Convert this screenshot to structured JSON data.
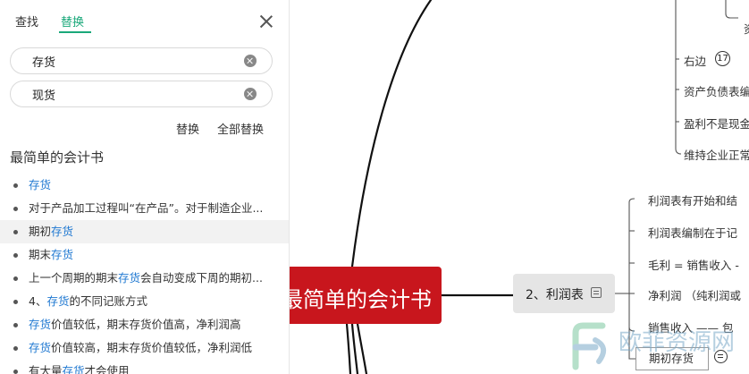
{
  "panel": {
    "tabs": [
      {
        "label": "查找",
        "active": false
      },
      {
        "label": "替换",
        "active": true
      }
    ],
    "find_value": "存货",
    "replace_value": "现货",
    "replace_label": "替换",
    "replace_all_label": "全部替换",
    "doc_title": "最简单的会计书",
    "results": [
      {
        "before": "",
        "match": "存货",
        "after": ""
      },
      {
        "before": "对于产品加工过程叫“在产品”。对于制造企业...",
        "match": "",
        "after": ""
      },
      {
        "before": "期初",
        "match": "存货",
        "after": "",
        "selected": true
      },
      {
        "before": "期末",
        "match": "存货",
        "after": ""
      },
      {
        "before": "上一个周期的期末",
        "match": "存货",
        "after": "会自动变成下周的期初..."
      },
      {
        "before": "4、",
        "match": "存货",
        "after": "的不同记账方式"
      },
      {
        "before": "",
        "match": "存货",
        "after": "价值较低，期末存货价值高，净利润高"
      },
      {
        "before": "",
        "match": "存货",
        "after": "价值较高，期末存货价值较低，净利润低"
      },
      {
        "before": "有大量",
        "match": "存货",
        "after": "才会使用"
      }
    ]
  },
  "mindmap": {
    "root_label": "最简单的会计书",
    "branch_label": "2、利润表",
    "upper_leaves": [
      "资",
      "右边",
      "资产负债表编",
      "盈利不是现金",
      "维持企业正常"
    ],
    "badge_value": "17",
    "lower_leaves": [
      "利润表有开始和结",
      "利润表编制在于记",
      "毛利 = 销售收入 -",
      "净利润  （纯利润或",
      "销售收入  ——  包"
    ],
    "boxed_leaf": "期初存货"
  },
  "watermark": {
    "text": "欧菲资源网"
  },
  "colors": {
    "accent": "#1aa87a",
    "highlight": "#1f78d1",
    "root_bg": "#c8161d",
    "branch_bg": "#e5e5e5"
  }
}
